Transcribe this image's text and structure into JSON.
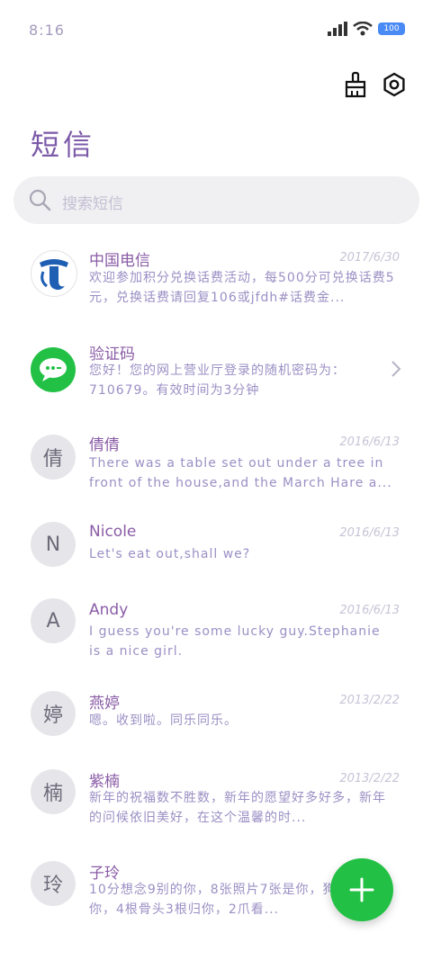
{
  "status": {
    "time": "8:16",
    "battery": "100"
  },
  "header": {
    "title": "短信"
  },
  "search": {
    "placeholder": "搜索短信"
  },
  "conversations": [
    {
      "sender": "中国电信",
      "date": "2017/6/30",
      "preview": "欢迎参加积分兑换话费活动，每500分可兑换话费5元，兑换话费请回复106或jfdh#话费金...",
      "avatar_type": "telecom-logo"
    },
    {
      "sender": "验证码",
      "date": "",
      "preview": "您好！您的网上营业厅登录的随机密码为：710679。有效时间为3分钟",
      "avatar_type": "message-icon"
    },
    {
      "sender": "倩倩",
      "date": "2016/6/13",
      "preview": "There was a table set out under a tree in front of the house,and the March Hare a...",
      "avatar_text": "倩"
    },
    {
      "sender": "Nicole",
      "date": "2016/6/13",
      "preview": "Let's eat out,shall we?",
      "avatar_text": "N"
    },
    {
      "sender": "Andy",
      "date": "2016/6/13",
      "preview": "I guess you're some lucky guy.Stephanie is a nice girl.",
      "avatar_text": "A"
    },
    {
      "sender": "燕婷",
      "date": "2013/2/22",
      "preview": "嗯。收到啦。同乐同乐。",
      "avatar_text": "婷"
    },
    {
      "sender": "紫楠",
      "date": "2013/2/22",
      "preview": "新年的祝福数不胜数，新年的愿望好多好多，新年的问候依旧美好，在这个温馨的时...",
      "avatar_text": "楠"
    },
    {
      "sender": "子玲",
      "date": "",
      "preview": "10分想念9别的你，8张照片7张是你，狗5只像你，4根骨头3根归你，2爪看...",
      "avatar_text": "玲"
    }
  ],
  "colors": {
    "accent": "#7b5aa8",
    "fab": "#22c145",
    "avatar_bg": "#e6e6ea"
  }
}
